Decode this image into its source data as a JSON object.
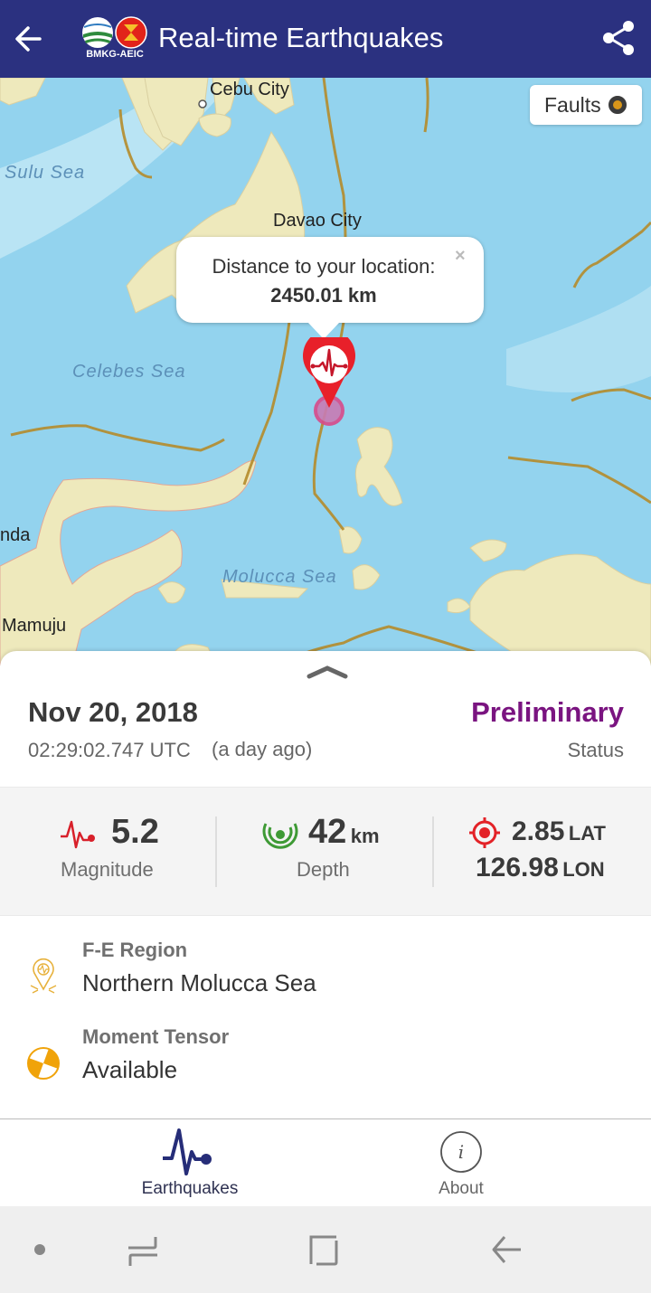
{
  "appbar": {
    "title": "Real-time Earthquakes",
    "logo_text": "BMKG-AEIC",
    "back_icon": "arrow-left-icon",
    "share_icon": "share-icon",
    "color": "#2b3180"
  },
  "map": {
    "places": [
      {
        "name": "Cebu City",
        "type": "city"
      },
      {
        "name": "Davao City",
        "type": "city"
      },
      {
        "name": "Mamuju",
        "type": "city"
      },
      {
        "name": "nda",
        "type": "city"
      }
    ],
    "seas": [
      "Sulu Sea",
      "Celebes Sea",
      "Molucca Sea"
    ],
    "faults_button": "Faults",
    "popup": {
      "line1": "Distance to your location:",
      "line2": "2450.01 km",
      "close": "×"
    },
    "marker_icon": "earthquake-marker-icon"
  },
  "event": {
    "date": "Nov 20, 2018",
    "time": "02:29:02.747 UTC",
    "ago": "(a day ago)",
    "status": "Preliminary",
    "status_label": "Status",
    "status_color": "#7a1480",
    "magnitude": "5.2",
    "magnitude_label": "Magnitude",
    "depth": "42",
    "depth_unit": "km",
    "depth_label": "Depth",
    "lat": "2.85",
    "lat_label": "LAT",
    "lon": "126.98",
    "lon_label": "LON",
    "region_label": "F-E Region",
    "region": "Northern Molucca Sea",
    "tensor_label": "Moment Tensor",
    "tensor": "Available"
  },
  "bottomnav": {
    "items": [
      {
        "label": "Earthquakes",
        "icon": "seismograph-icon",
        "active": true
      },
      {
        "label": "About",
        "icon": "info-icon",
        "active": false
      }
    ]
  },
  "sysnav": {
    "items": [
      "dot",
      "recents",
      "home",
      "back"
    ]
  }
}
